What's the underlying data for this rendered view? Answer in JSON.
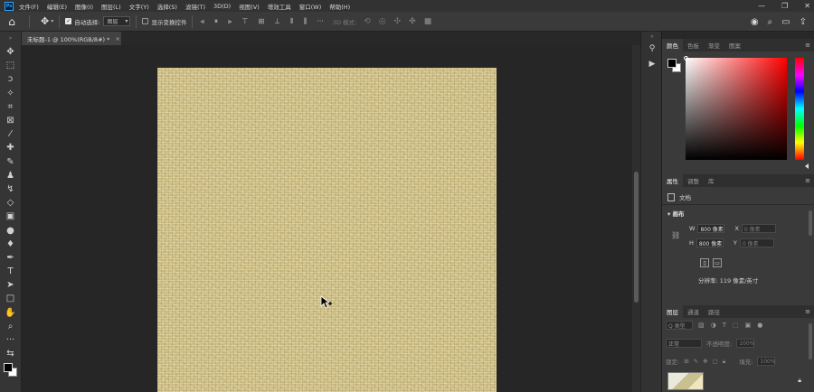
{
  "app": {
    "logo": "Ps"
  },
  "menu": [
    "文件(F)",
    "编辑(E)",
    "图像(I)",
    "图层(L)",
    "文字(Y)",
    "选择(S)",
    "滤镜(T)",
    "3D(D)",
    "视图(V)",
    "增效工具",
    "窗口(W)",
    "帮助(H)"
  ],
  "window_controls": {
    "minimize": "—",
    "restore": "❐",
    "close": "✕"
  },
  "options": {
    "auto_select_label": "自动选择:",
    "auto_select_value": "图层",
    "show_transform_label": "显示变换控件",
    "mode_3d_label": "3D 模式:"
  },
  "document": {
    "tab_title": "未标题-1 @ 100%(RGB/8#) *",
    "tab_close": "×"
  },
  "panels": {
    "color": {
      "tabs": [
        "颜色",
        "色板",
        "渐变",
        "图案"
      ]
    },
    "properties": {
      "tabs": [
        "属性",
        "调整",
        "库"
      ],
      "doc_label": "文档",
      "canvas_heading": "画布",
      "w_label": "W",
      "w_value": "800 像素",
      "h_label": "H",
      "h_value": "800 像素",
      "x_label": "X",
      "x_placeholder": "0 像素",
      "y_label": "Y",
      "y_placeholder": "0 像素",
      "resolution": "分辨率: 119 像素/英寸"
    },
    "layers": {
      "tabs": [
        "图层",
        "通道",
        "路径"
      ],
      "kind_filter": "Q 类型",
      "blend_mode": "正常",
      "opacity_label": "不透明度:",
      "opacity_value": "100%",
      "lock_label": "锁定:",
      "fill_label": "填充:",
      "fill_value": "100%"
    }
  }
}
